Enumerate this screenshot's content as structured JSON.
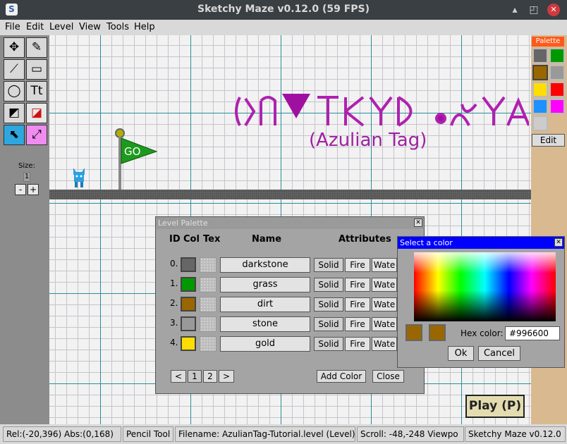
{
  "window": {
    "title": "Sketchy Maze v0.12.0 (59 FPS)",
    "icon": "S"
  },
  "menu": [
    "File",
    "Edit",
    "Level",
    "View",
    "Tools",
    "Help"
  ],
  "tools": [
    {
      "name": "pan-tool",
      "glyph": "✥"
    },
    {
      "name": "pencil-tool",
      "glyph": "✎"
    },
    {
      "name": "line-tool",
      "glyph": "⟋"
    },
    {
      "name": "rectangle-tool",
      "glyph": "▭"
    },
    {
      "name": "ellipse-tool",
      "glyph": "◯"
    },
    {
      "name": "text-tool",
      "glyph": "Tt"
    },
    {
      "name": "fill-tool",
      "glyph": "◩"
    },
    {
      "name": "eraser-tool",
      "glyph": "◪"
    },
    {
      "name": "actor-tool",
      "glyph": "⬉"
    },
    {
      "name": "link-tool",
      "glyph": "⤢"
    }
  ],
  "size": {
    "label": "Size:",
    "value": "1",
    "minus": "-",
    "plus": "+"
  },
  "canvas": {
    "subtitle": "(Azulian Tag)",
    "flag_text": "GO"
  },
  "palette": {
    "title": "Palette",
    "swatches": [
      "#666666",
      "#009900",
      "#996600",
      "#999999",
      "#ffdd00",
      "#ff0000",
      "#1e90ff",
      "#ff00ff",
      "#cccccc"
    ],
    "edit_label": "Edit"
  },
  "play_label": "Play (P)",
  "status": [
    "Rel:(-20,396)  Abs:(0,168)",
    "Pencil Tool",
    "Filename: AzulianTag-Tutorial.level (Level)",
    "Scroll: -48,-248   Viewpo",
    "Sketchy Maze v0.12.0"
  ],
  "level_palette": {
    "title": "Level Palette",
    "headers": {
      "id": "ID",
      "col": "Col",
      "tex": "Tex",
      "name": "Name",
      "attrs": "Attributes"
    },
    "rows": [
      {
        "id": "0.",
        "color": "#666666",
        "name": "darkstone"
      },
      {
        "id": "1.",
        "color": "#009900",
        "name": "grass"
      },
      {
        "id": "2.",
        "color": "#996600",
        "name": "dirt"
      },
      {
        "id": "3.",
        "color": "#999999",
        "name": "stone"
      },
      {
        "id": "4.",
        "color": "#ffdd00",
        "name": "gold"
      }
    ],
    "attr_labels": {
      "solid": "Solid",
      "fire": "Fire",
      "water": "Wate"
    },
    "pager": {
      "prev": "<",
      "p1": "1",
      "p2": "2",
      "next": ">"
    },
    "add_color": "Add Color",
    "close": "Close"
  },
  "color_picker": {
    "title": "Select a color",
    "hex_label": "Hex color:",
    "hex_value": "#996600",
    "ok": "Ok",
    "cancel": "Cancel"
  }
}
